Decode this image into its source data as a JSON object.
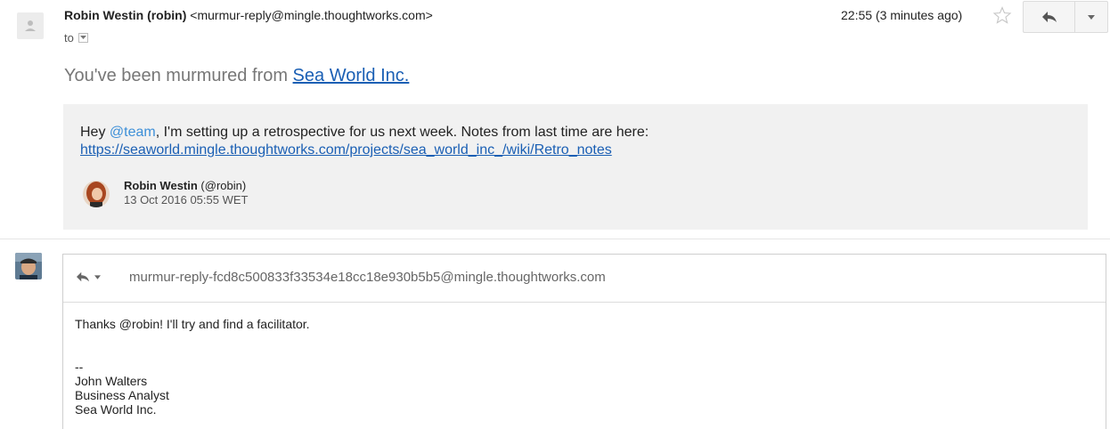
{
  "message": {
    "sender_name": "Robin Westin (robin)",
    "sender_email": "<murmur-reply@mingle.thoughtworks.com>",
    "to_label": "to",
    "time": "22:55 (3 minutes ago)",
    "icons": {
      "sender_avatar": "default-person-icon",
      "star": "star-icon",
      "reply": "reply-icon",
      "more": "chevron-down-icon"
    }
  },
  "murmur": {
    "heading_prefix": "You've been murmured from ",
    "heading_link": "Sea World Inc.",
    "text_greeting": "Hey ",
    "text_mention": "@team",
    "text_body": ", I'm setting up a retrospective for us next week. Notes from last time are here: ",
    "text_link": "https://seaworld.mingle.thoughtworks.com/projects/sea_world_inc_/wiki/Retro_notes",
    "author_name": "Robin Westin",
    "author_handle": " (@robin)",
    "author_date": "13 Oct 2016 05:55 WET"
  },
  "reply": {
    "address": "murmur-reply-fcd8c500833f33534e18cc18e930b5b5@mingle.thoughtworks.com",
    "body_lines": [
      "Thanks @robin! I'll try and find a facilitator."
    ],
    "signature": [
      "--",
      "John Walters",
      "Business Analyst",
      "Sea World Inc."
    ]
  },
  "colors": {
    "mention": "#3d8fd8",
    "link": "#1a5fb4",
    "card_background": "#f1f1f1"
  }
}
